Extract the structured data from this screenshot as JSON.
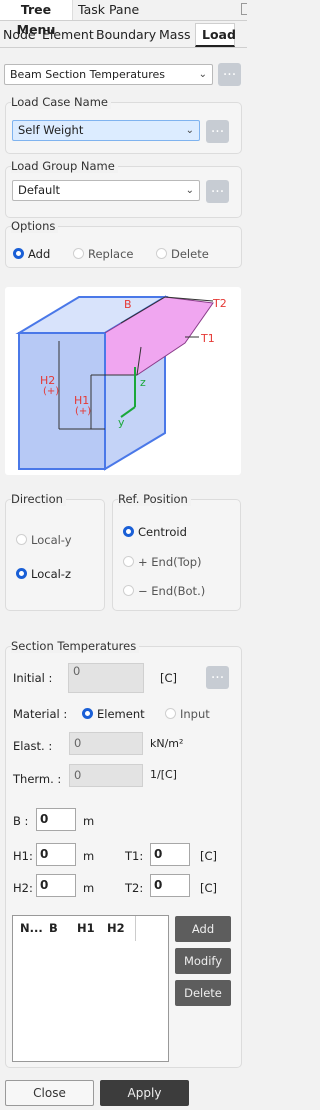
{
  "top_tabs": {
    "tree_menu": "Tree Menu",
    "task_pane": "Task Pane"
  },
  "sub_tabs": {
    "node": "Node",
    "element": "Element",
    "boundary": "Boundary",
    "mass": "Mass",
    "load": "Load"
  },
  "load_type": {
    "value": "Beam Section Temperatures"
  },
  "load_case": {
    "label": "Load Case Name",
    "value": "Self Weight"
  },
  "load_group": {
    "label": "Load Group Name",
    "value": "Default"
  },
  "options": {
    "label": "Options",
    "add": "Add",
    "replace": "Replace",
    "delete": "Delete"
  },
  "figure": {
    "B": "B",
    "T1": "T1",
    "T2": "T2",
    "H1": "H1",
    "H1_sign": "(+)",
    "H2": "H2",
    "H2_sign": "(+)",
    "z": "z",
    "y": "y"
  },
  "direction": {
    "label": "Direction",
    "local_y": "Local-y",
    "local_z": "Local-z"
  },
  "ref_position": {
    "label": "Ref. Position",
    "centroid": "Centroid",
    "end_top": "+ End(Top)",
    "end_bot": "− End(Bot.)"
  },
  "section_temps": {
    "label": "Section Temperatures",
    "initial_label": "Initial :",
    "initial_value": "0",
    "initial_unit": "[C]",
    "material_label": "Material :",
    "material_element": "Element",
    "material_input": "Input",
    "elast_label": "Elast. :",
    "elast_value": "0",
    "elast_unit": "kN/m²",
    "therm_label": "Therm. :",
    "therm_value": "0",
    "therm_unit": "1/[C]",
    "B_label": "B :",
    "B_value": "0",
    "B_unit": "m",
    "H1_label": "H1:",
    "H1_value": "0",
    "H1_unit": "m",
    "H2_label": "H2:",
    "H2_value": "0",
    "H2_unit": "m",
    "T1_label": "T1:",
    "T1_value": "0",
    "T1_unit": "[C]",
    "T2_label": "T2:",
    "T2_value": "0",
    "T2_unit": "[C]"
  },
  "table": {
    "columns": [
      "N...",
      "B",
      "H1",
      "H2"
    ]
  },
  "buttons": {
    "add": "Add",
    "modify": "Modify",
    "delete": "Delete",
    "close": "Close",
    "apply": "Apply",
    "dots": "..."
  },
  "colors": {
    "accent": "#1a5fd6",
    "blue_face": "#b7c9f5",
    "pink_face": "#f0a6f0",
    "red": "#e53935",
    "green": "#1aa83a"
  }
}
